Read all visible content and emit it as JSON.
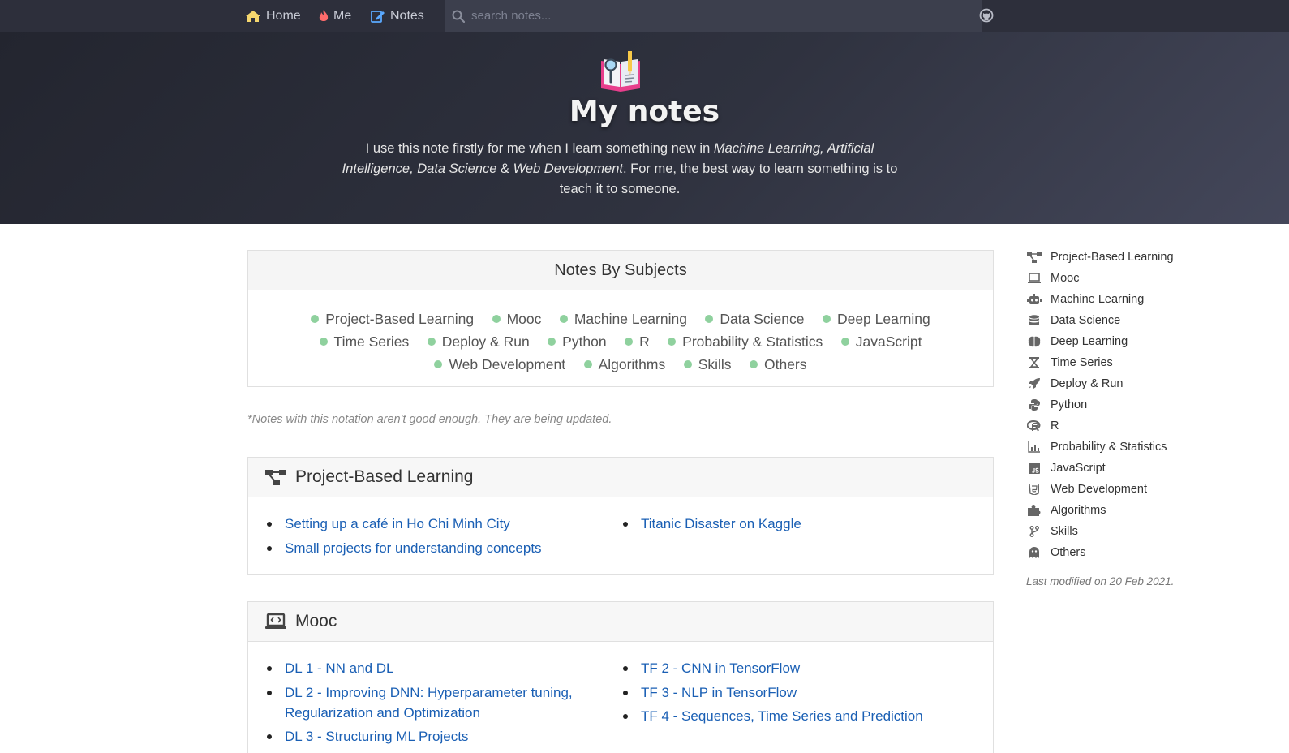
{
  "nav": {
    "home_label": "Home",
    "me_label": "Me",
    "notes_label": "Notes",
    "search_placeholder": "search notes..."
  },
  "hero": {
    "title": "My notes",
    "desc_prefix": "I use this note firstly for me when I learn something new in ",
    "desc_topics_1": "Machine Learning, Artificial Intelligence, Data Science",
    "desc_amp": " & ",
    "desc_topics_2": "Web Development",
    "desc_suffix": ". For me, the best way to learn something is to teach it to someone."
  },
  "subjects_card": {
    "title": "Notes By Subjects",
    "tags": [
      "Project-Based Learning",
      "Mooc",
      "Machine Learning",
      "Data Science",
      "Deep Learning",
      "Time Series",
      "Deploy & Run",
      "Python",
      "R",
      "Probability & Statistics",
      "JavaScript",
      "Web Development",
      "Algorithms",
      "Skills",
      "Others"
    ]
  },
  "disclaimer": "*Notes with this notation aren't good enough. They are being updated.",
  "sections": {
    "pbl": {
      "title": "Project-Based Learning",
      "left": [
        "Setting up a café in Ho Chi Minh City",
        "Small projects for understanding concepts"
      ],
      "right": [
        "Titanic Disaster on Kaggle"
      ]
    },
    "mooc": {
      "title": "Mooc",
      "left": [
        "DL 1 - NN and DL",
        "DL 2 - Improving DNN: Hyperparameter tuning, Regularization and Optimization",
        "DL 3 - Structuring ML Projects"
      ],
      "right": [
        "TF 2 - CNN in TensorFlow",
        "TF 3 - NLP in TensorFlow",
        "TF 4 - Sequences, Time Series and Prediction"
      ]
    }
  },
  "sidebar": {
    "items": [
      {
        "label": "Project-Based Learning",
        "icon": "project-diagram-icon"
      },
      {
        "label": "Mooc",
        "icon": "laptop-code-icon"
      },
      {
        "label": "Machine Learning",
        "icon": "robot-icon"
      },
      {
        "label": "Data Science",
        "icon": "database-icon"
      },
      {
        "label": "Deep Learning",
        "icon": "brain-icon"
      },
      {
        "label": "Time Series",
        "icon": "hourglass-icon"
      },
      {
        "label": "Deploy & Run",
        "icon": "rocket-icon"
      },
      {
        "label": "Python",
        "icon": "python-icon"
      },
      {
        "label": "R",
        "icon": "r-project-icon"
      },
      {
        "label": "Probability & Statistics",
        "icon": "chart-bar-icon"
      },
      {
        "label": "JavaScript",
        "icon": "js-icon"
      },
      {
        "label": "Web Development",
        "icon": "html5-icon"
      },
      {
        "label": "Algorithms",
        "icon": "puzzle-piece-icon"
      },
      {
        "label": "Skills",
        "icon": "code-branch-icon"
      },
      {
        "label": "Others",
        "icon": "ghost-icon"
      }
    ],
    "last_modified": "Last modified on 20 Feb 2021."
  },
  "colors": {
    "navbar_bg": "#2d2f3b",
    "link": "#1a5fb4",
    "tag_dot": "#8fd19e",
    "fire_icon": "#ff6b6b",
    "notes_icon": "#5aa9ff"
  }
}
